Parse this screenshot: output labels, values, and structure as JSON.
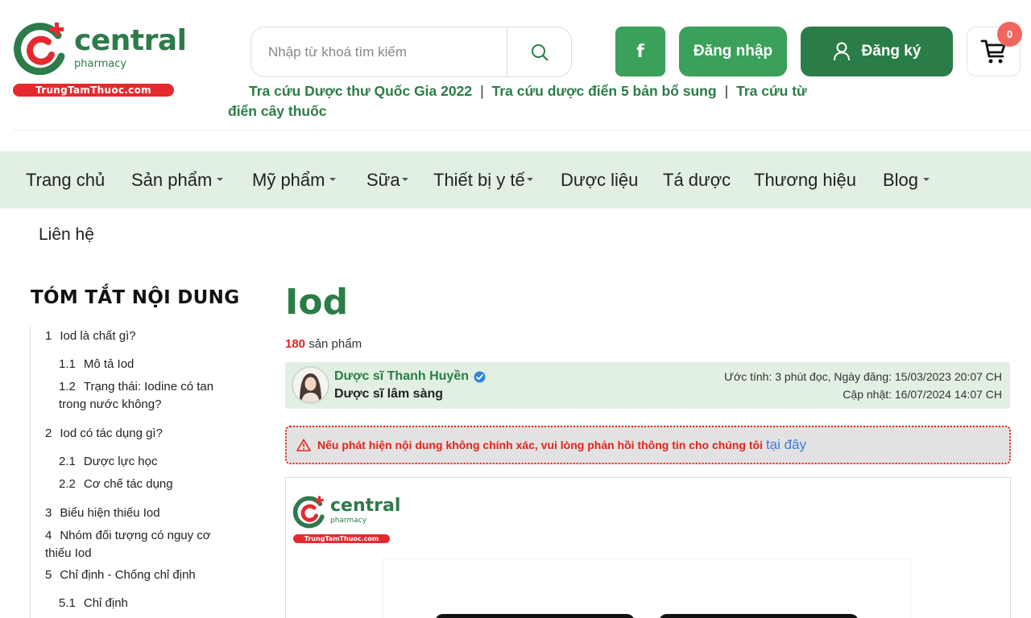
{
  "header": {
    "logo": {
      "word": "central",
      "sub": "pharmacy",
      "domain": "TrungTamThuoc.com"
    },
    "search": {
      "placeholder": "Nhập từ khoá tìm kiếm",
      "icon": "search-icon"
    },
    "facebook": {
      "label": "f",
      "icon": "facebook-icon"
    },
    "login_label": "Đăng nhập",
    "register_label": "Đăng ký",
    "cart": {
      "count": "0",
      "icon": "cart-icon"
    },
    "quick_links": [
      "Tra cứu Dược thư Quốc Gia 2022",
      "Tra cứu dược điển 5 bản bổ sung",
      "Tra cứu từ điển cây thuốc"
    ],
    "separator": "|"
  },
  "nav": {
    "items": [
      {
        "label": "Trang chủ",
        "dropdown": false
      },
      {
        "label": "Sản phẩm",
        "dropdown": true
      },
      {
        "label": "Mỹ phẩm",
        "dropdown": true
      },
      {
        "label": "Sữa",
        "dropdown": true
      },
      {
        "label": "Thiết bị y tế",
        "dropdown": true
      },
      {
        "label": "Dược liệu",
        "dropdown": false
      },
      {
        "label": "Tá dược",
        "dropdown": false
      },
      {
        "label": "Thương hiệu",
        "dropdown": false
      },
      {
        "label": "Blog",
        "dropdown": true
      }
    ],
    "extra": "Liên hệ"
  },
  "toc": {
    "title": "TÓM TẮT NỘI DUNG",
    "items": [
      {
        "num": "1",
        "label": "Iod là chất gì?"
      },
      {
        "num": "1.1",
        "label": "Mô tả Iod"
      },
      {
        "num": "1.2",
        "label": "Trạng thái: Iodine có tan trong nước không?"
      },
      {
        "num": "2",
        "label": "Iod có tác dụng gì?"
      },
      {
        "num": "2.1",
        "label": "Dược lực học"
      },
      {
        "num": "2.2",
        "label": "Cơ chế tác dụng"
      },
      {
        "num": "3",
        "label": "Biểu hiện thiếu Iod"
      },
      {
        "num": "4",
        "label": "Nhóm đối tượng có nguy cơ thiếu Iod"
      },
      {
        "num": "5",
        "label": "Chỉ định - Chống chỉ định"
      },
      {
        "num": "5.1",
        "label": "Chỉ định"
      }
    ]
  },
  "main": {
    "title": "Iod",
    "product_count": "180",
    "product_count_suffix": "sản phẩm",
    "author": {
      "name": "Dược sĩ Thanh Huyền",
      "role": "Dược sĩ lâm sàng",
      "meta_line1": "Ước tính: 3 phút đọc, Ngày đăng: 15/03/2023 20:07 CH",
      "meta_line2": "Cập nhật: 16/07/2024 14:07 CH"
    },
    "alert": {
      "text": "Nếu phát hiện nội dung không chính xác, vui lòng phản hồi thông tin cho chúng tôi",
      "link": "tại đây"
    }
  },
  "colors": {
    "brand_green": "#2a7d46",
    "button_green": "#3aa05a",
    "nav_bg": "#e1f0e2",
    "accent_red": "#e5231c",
    "link_blue": "#3d7ed6"
  }
}
